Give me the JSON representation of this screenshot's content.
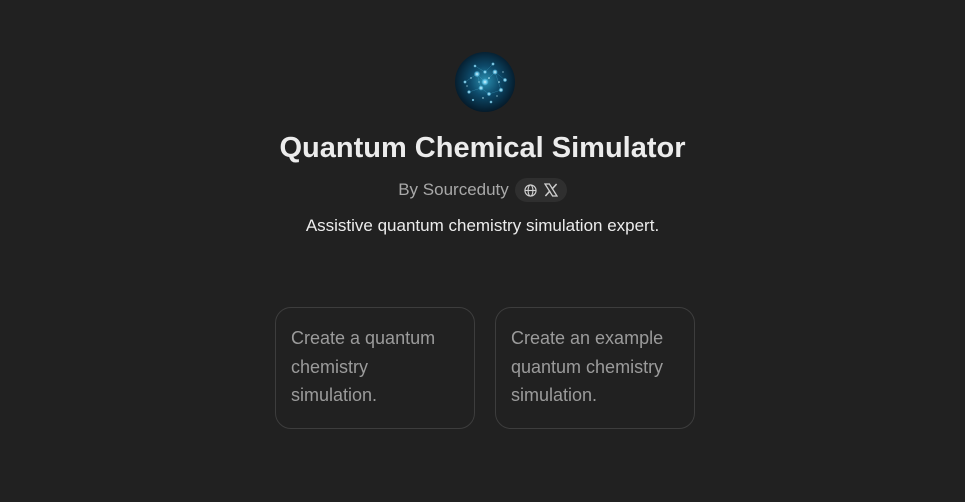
{
  "gpt": {
    "avatar_icon": "quantum-particles-icon",
    "title": "Quantum Chemical Simulator",
    "author": "By Sourceduty",
    "social_icons": [
      "globe-icon",
      "x-logo-icon"
    ],
    "description": "Assistive quantum chemistry simulation expert."
  },
  "starters": [
    {
      "label": "Create a quantum chemistry simulation."
    },
    {
      "label": "Create an example quantum chemistry simulation."
    }
  ],
  "colors": {
    "background": "#212121",
    "title": "#ececec",
    "muted": "#a8a8a8",
    "starter_border": "#3d3d3d",
    "starter_text": "#9b9b9b",
    "pill": "#2f2f2f"
  }
}
